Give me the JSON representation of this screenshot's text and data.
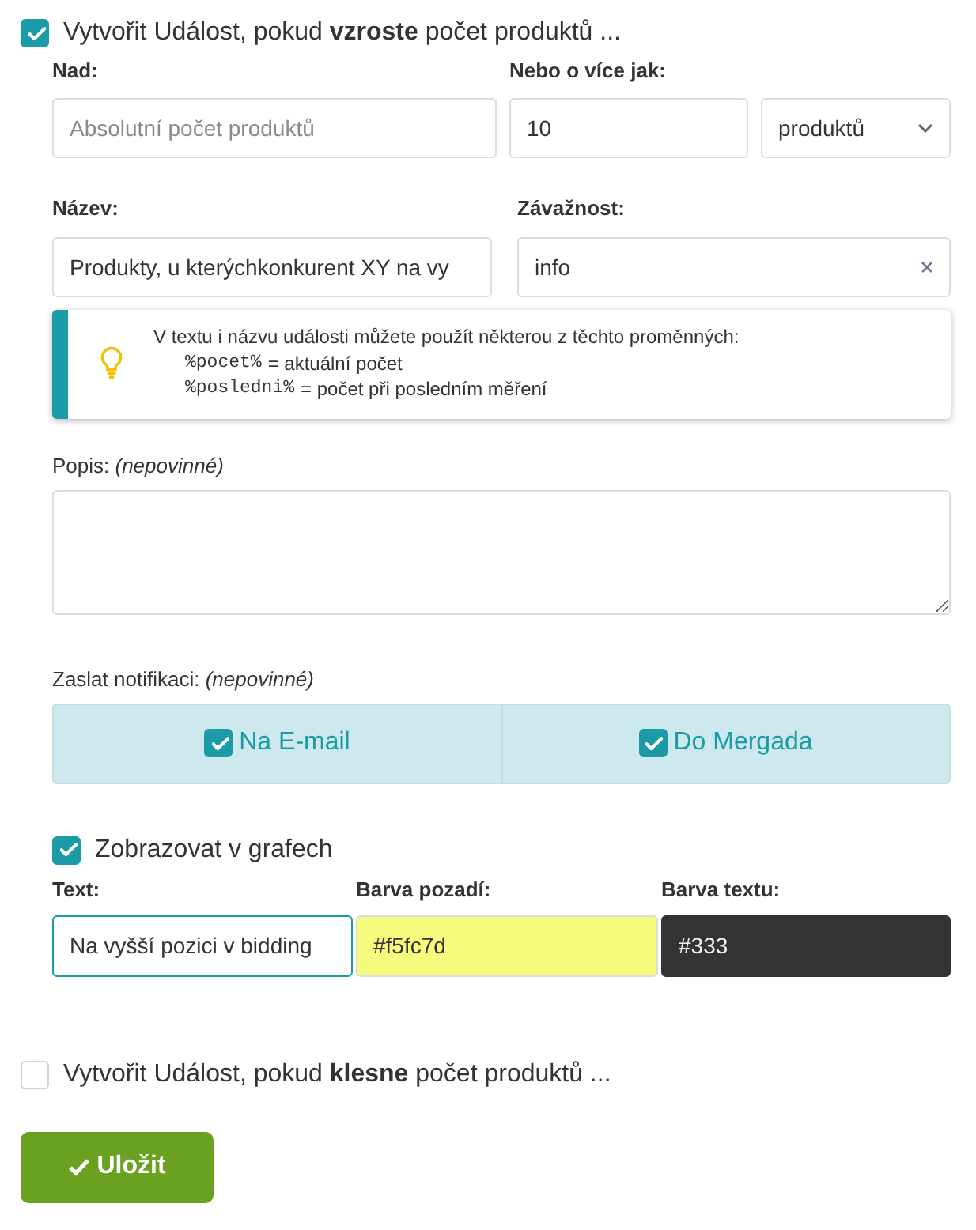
{
  "sections": [
    {
      "title": "Vytvořit Událost, pokud **vzroste** počet produktů ...",
      "checked": true,
      "threshold": {
        "label": "Nad:",
        "placeholder": "Absolutní počet produktů"
      },
      "minimum": {
        "label": "Nebo o více jak:",
        "value": "10",
        "unit": "produktů"
      },
      "name": {
        "label": "Název:",
        "value": "Produkty, u kterýchkonkurent XY na vy"
      },
      "severity": {
        "label": "Závažnost:",
        "value": "info"
      },
      "hint": {
        "text": "V textu i názvu události můžete použít některou z těchto proměnných:",
        "variables": [
          {
            "code": "%pocet%",
            "meaning": "= aktuální počet"
          },
          {
            "code": "%posledni%",
            "meaning": "= počet při posledním měření"
          }
        ]
      },
      "description": {
        "label": "Popis: *(nepovinné)*"
      },
      "notifications": {
        "label": "Zaslat notifikaci: *(nepovinné)*",
        "options": [
          {
            "label": "Na E-mail",
            "checked": true
          },
          {
            "label": "Do Mergada",
            "checked": true
          }
        ]
      },
      "graphs": {
        "label": "Zobrazovat v grafech",
        "checked": true,
        "fields": [
          {
            "kind": "text",
            "label": "Text:",
            "value": "Na vyšší pozici v bidding",
            "focused": true
          },
          {
            "kind": "color",
            "label": "Barva pozadí:",
            "value": "#f5fc7d",
            "color": "#f5fc7d"
          },
          {
            "kind": "color",
            "label": "Barva textu:",
            "value": "#333",
            "color": "#333333"
          }
        ]
      }
    },
    {
      "title": "Vytvořit Událost, pokud **klesne** počet produktů ...",
      "checked": false
    }
  ],
  "save_button": {
    "label": "Uložit"
  }
}
